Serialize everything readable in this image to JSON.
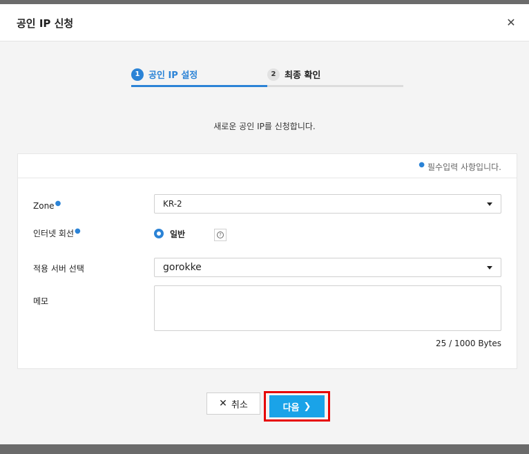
{
  "dialog": {
    "title": "공인 IP 신청",
    "close_icon": "close-icon"
  },
  "steps": [
    {
      "number": "1",
      "label": "공인 IP 설정",
      "active": true
    },
    {
      "number": "2",
      "label": "최종 확인",
      "active": false
    }
  ],
  "intro": "새로운 공인 IP를 신청합니다.",
  "form": {
    "required_note": "필수입력 사항입니다.",
    "zone": {
      "label": "Zone",
      "value": "KR-2"
    },
    "internet_line": {
      "label": "인터넷 회선",
      "option": "일반",
      "help_icon": "question-circle-icon"
    },
    "server": {
      "label": "적용 서버 선택",
      "value": "gorokke"
    },
    "memo": {
      "label": "메모",
      "value": "",
      "bytes": "25 / 1000 Bytes"
    }
  },
  "buttons": {
    "cancel": "취소",
    "next": "다음"
  },
  "colors": {
    "accent": "#2b83d6",
    "next_button": "#1aa3e8",
    "highlight_box": "#e60000"
  }
}
